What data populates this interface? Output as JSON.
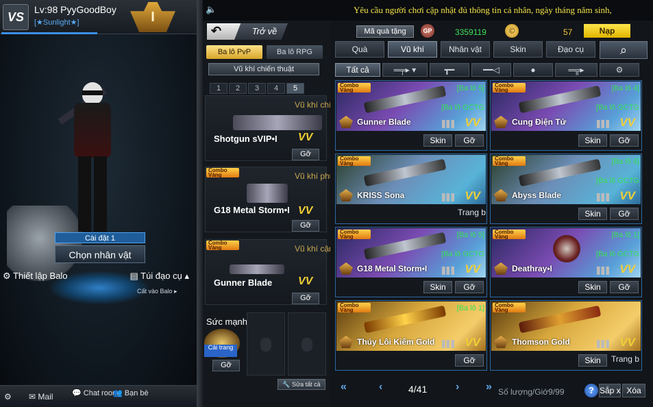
{
  "profile": {
    "level": "Lv:98 PyyGoodBoy",
    "clan": "[★Sunlight★]",
    "rank": "I",
    "logo": "VS"
  },
  "left": {
    "setting_label": "Cài đặt 1",
    "choose_char": "Chọn nhân vật",
    "setup_bag": "Thiết lập Balo",
    "item_bag": "Túi đạo cụ",
    "store_bag": "Cất vào Balo"
  },
  "bottom_nav": {
    "mail": "Mail",
    "chat": "Chat room",
    "friends": "Bạn bè"
  },
  "notice": "Yêu cầu người chơi cập nhật đủ thông tin cá nhân, ngày tháng năm sinh,",
  "back": {
    "arrow": "↶",
    "label": "Trở về"
  },
  "bag_tabs": {
    "pvp": "Ba lô PvP",
    "rpg": "Ba lô RPG"
  },
  "tactical": "Vũ khí chiến thuật",
  "pages": [
    "1",
    "2",
    "3",
    "4",
    "5"
  ],
  "active_page": "5",
  "slots": [
    {
      "category": "Vũ khí chính",
      "name": "Shotgun sVIP•I",
      "vv": "VV",
      "remove": "Gỡ",
      "combo": false
    },
    {
      "category": "Vũ khí phụ",
      "name": "G18 Metal Storm•I",
      "vv": "VV",
      "remove": "Gỡ",
      "combo": true
    },
    {
      "category": "Vũ khí cận",
      "name": "Gunner Blade",
      "vv": "VV",
      "remove": "Gỡ",
      "combo": true
    }
  ],
  "combo_label": "Combo Vàng",
  "strength": {
    "label": "Sức mạnh",
    "costume": "Cải trang",
    "remove": "Gỡ"
  },
  "repair_all": "Sửa tất cả",
  "currency": {
    "gift_code": "Mã quà tặng",
    "gp_icon": "GP",
    "gp": "3359119",
    "coin_icon": "©",
    "coin": "57",
    "topup": "Nạp"
  },
  "category_tabs": [
    "Quà",
    "Vũ khí",
    "Nhân vật",
    "Skin",
    "Đạo cụ"
  ],
  "active_category": "Vũ khí",
  "search_icon": "search-icon",
  "sub_tabs": {
    "all": "Tất cả",
    "icons": [
      "rifle-icon",
      "pistol-icon",
      "knife-icon",
      "grenade-icon",
      "special-weapon-icon",
      "settings-icon"
    ]
  },
  "cards": [
    {
      "name": "Gunner Blade",
      "tag1": "[Ba lô 5]",
      "tag2": "[Ba lô GCTG",
      "vv": "VV",
      "btn1": "Skin",
      "btn2": "Gỡ",
      "style": "purple"
    },
    {
      "name": "Cung Điện Tử",
      "tag1": "[Ba lô 4]",
      "tag2": "[Ba lô GCTG",
      "vv": "VV",
      "btn1": "Skin",
      "btn2": "Gỡ",
      "style": "purple"
    },
    {
      "name": "KRISS Sona",
      "tag1": "",
      "tag2": "",
      "vv": "VV",
      "btn1": "",
      "btn2": "Trang b",
      "style": "green"
    },
    {
      "name": "Abyss Blade",
      "tag1": "[Ba lô 4]",
      "tag2": "[Ba lô GCTG",
      "vv": "VV",
      "btn1": "Skin",
      "btn2": "Gỡ",
      "style": "green"
    },
    {
      "name": "G18 Metal Storm•I",
      "tag1": "[Ba lô 5]",
      "tag2": "[Ba lô GCTG",
      "vv": "VV",
      "btn1": "Skin",
      "btn2": "Gỡ",
      "style": "purple"
    },
    {
      "name": "Deathray•I",
      "tag1": "[Ba lô 1]",
      "tag2": "[Ba lô GCTG",
      "vv": "VV",
      "btn1": "Skin",
      "btn2": "Gỡ",
      "style": "purple"
    },
    {
      "name": "Thúy Lôi Kiếm Gold",
      "tag1": "[Ba lô 1]",
      "tag2": "",
      "vv": "VV",
      "btn1": "",
      "btn2": "Gỡ",
      "style": "gold"
    },
    {
      "name": "Thomson Gold",
      "tag1": "",
      "tag2": "",
      "vv": "VV",
      "btn1": "Skin",
      "btn2": "Trang b",
      "style": "gold"
    }
  ],
  "pager": {
    "page": "4/41",
    "first": "«",
    "prev": "‹",
    "next": "›",
    "last": "»"
  },
  "quantity": "Số lượng/Giớ9/99",
  "help": "?",
  "sort": "Sắp x",
  "delete": "Xóa"
}
